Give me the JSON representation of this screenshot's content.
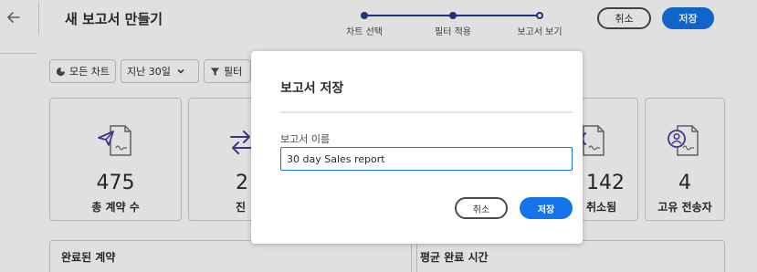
{
  "header": {
    "back_icon": "arrow-left-icon",
    "title": "새 보고서 만들기",
    "steps": [
      {
        "label": "차트 선택",
        "state": "complete"
      },
      {
        "label": "필터 적용",
        "state": "complete"
      },
      {
        "label": "보고서 보기",
        "state": "current"
      }
    ],
    "cancel_label": "취소",
    "save_label": "저장"
  },
  "filters": [
    {
      "label": "모든 차트",
      "icon": "pie-chart-icon"
    },
    {
      "label": "지난 30일",
      "icon": "chevron-down-icon"
    },
    {
      "label": "필터",
      "icon": "funnel-icon"
    }
  ],
  "cards": [
    {
      "value": "475",
      "label": "총 계약 수",
      "icon": "sent-document-icon"
    },
    {
      "value": "2",
      "label": "진",
      "icon": "swap-arrows-icon"
    },
    {
      "value": "142",
      "label": "취소됨",
      "icon": "cancelled-document-icon"
    },
    {
      "value": "4",
      "label": "고유 전송자",
      "icon": "user-document-icon"
    }
  ],
  "panels": [
    {
      "title": "완료된 계약"
    },
    {
      "title": "평균 완료 시간"
    }
  ],
  "modal": {
    "title": "보고서 저장",
    "field_label": "보고서 이름",
    "field_value": "30 day Sales report",
    "cancel_label": "취소",
    "save_label": "저장"
  },
  "colors": {
    "accent": "#1473e6",
    "stepper": "#1f3e8f",
    "icon_purple": "#4b3d98"
  }
}
